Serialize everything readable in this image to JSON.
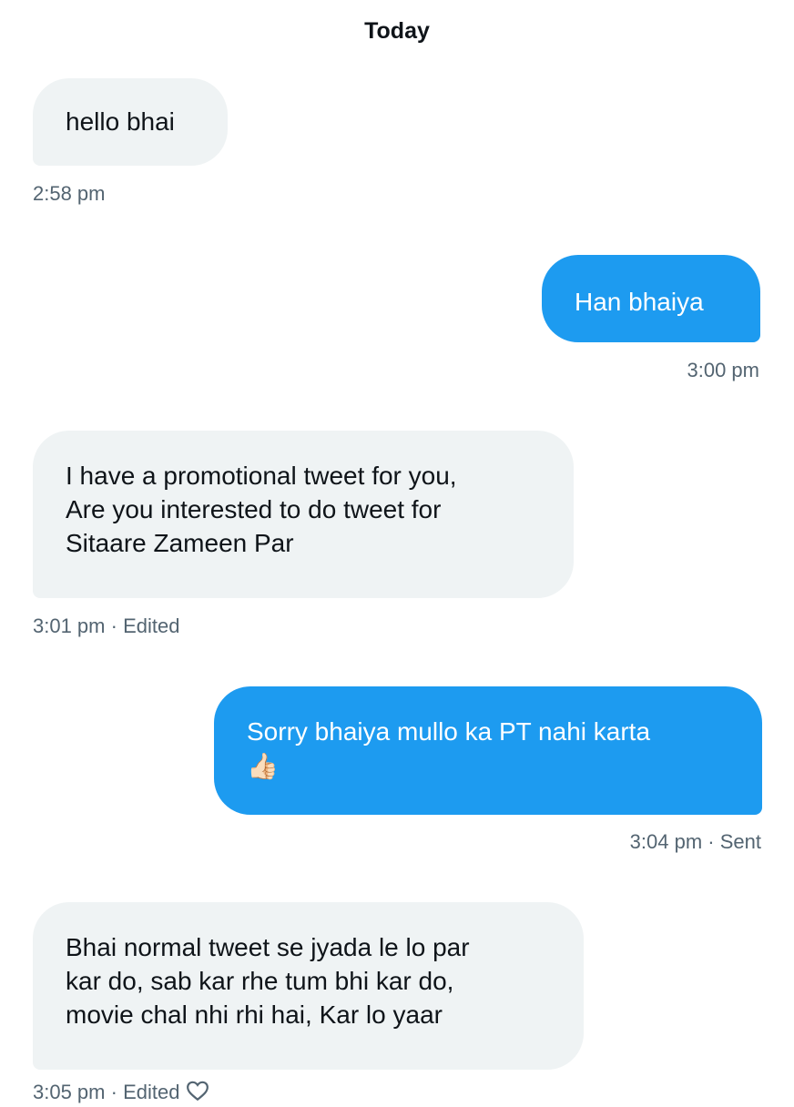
{
  "day_header": "Today",
  "messages": [
    {
      "direction": "received",
      "lines": [
        "hello bhai"
      ],
      "time": "2:58 pm"
    },
    {
      "direction": "sent",
      "lines": [
        "Han bhaiya"
      ],
      "time": "3:00 pm"
    },
    {
      "direction": "received",
      "lines": [
        "I have a promotional tweet for you,",
        "Are you interested to do tweet for",
        "Sitaare Zameen Par"
      ],
      "time": "3:01 pm",
      "status": "Edited"
    },
    {
      "direction": "sent",
      "lines": [
        "Sorry bhaiya mullo ka PT nahi karta"
      ],
      "emoji": "👍🏻",
      "time": "3:04 pm",
      "status": "Sent"
    },
    {
      "direction": "received",
      "lines": [
        "Bhai normal tweet se jyada le lo par",
        "kar do, sab kar rhe tum bhi kar do,",
        "movie chal nhi rhi hai, Kar lo yaar"
      ],
      "time": "3:05 pm",
      "status": "Edited"
    }
  ],
  "separator": "·",
  "colors": {
    "sent_bubble": "#1d9bf0",
    "received_bubble": "#eff3f4",
    "meta_text": "#536471"
  }
}
